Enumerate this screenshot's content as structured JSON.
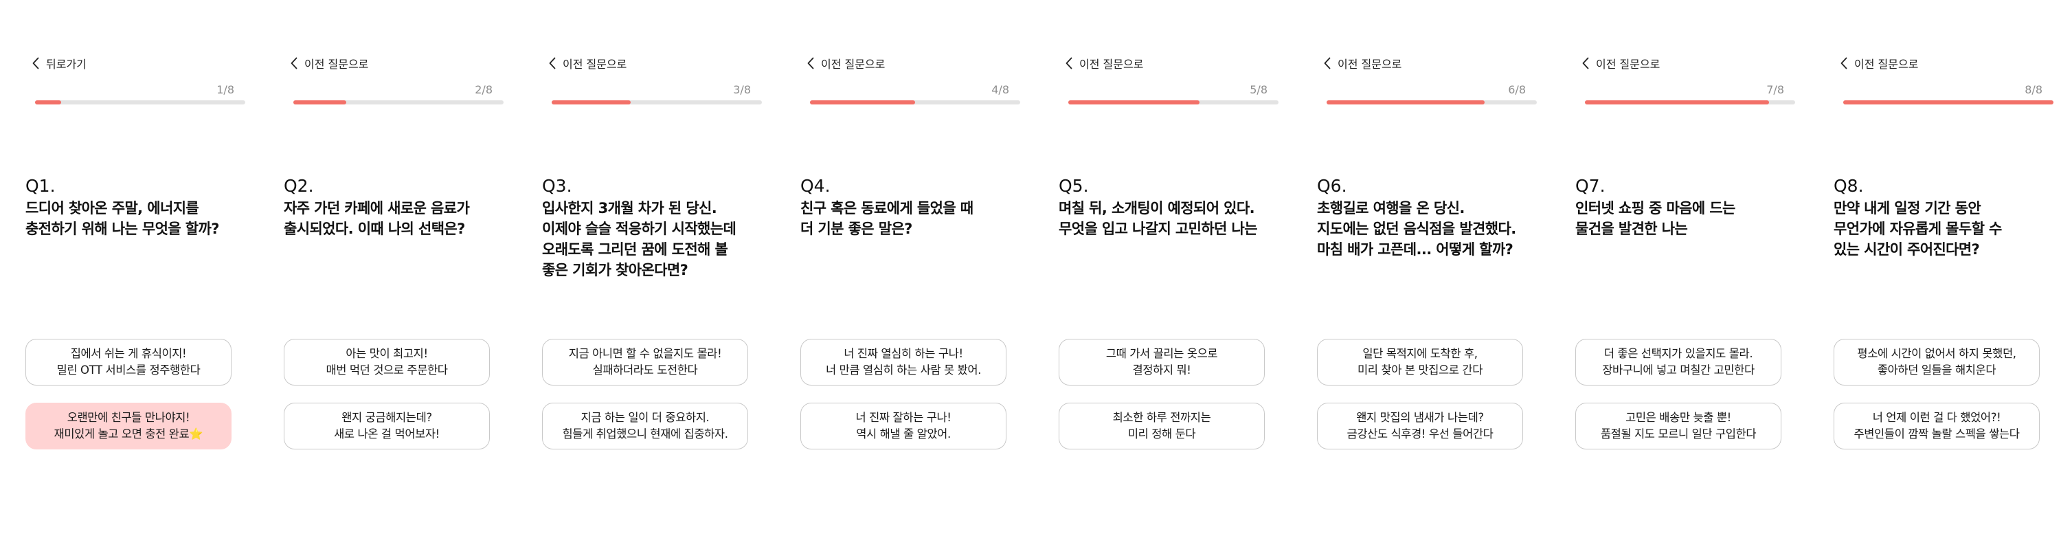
{
  "colors": {
    "accent": "#f27068",
    "track": "#e3e3e3",
    "selected": "#ffd3d3"
  },
  "screens": [
    {
      "back_label": "뒤로가기",
      "counter": "1/8",
      "progress": 0.125,
      "q_num": "Q1.",
      "q_text": "드디어 찾아온 주말, 에너지를\n충전하기 위해 나는 무엇을 할까?",
      "option_a": "집에서 쉬는 게 휴식이지!\n밀린 OTT 서비스를 정주행한다",
      "option_b": "오랜만에 친구들 만나야지!\n재미있게 놀고 오면 충전 완료⭐",
      "selected": "b"
    },
    {
      "back_label": "이전 질문으로",
      "counter": "2/8",
      "progress": 0.25,
      "q_num": "Q2.",
      "q_text": "자주 가던 카페에 새로운 음료가\n출시되었다. 이때 나의 선택은?",
      "option_a": "아는 맛이 최고지!\n매번 먹던 것으로 주문한다",
      "option_b": "왠지 궁금해지는데?\n새로 나온 걸 먹어보자!",
      "selected": ""
    },
    {
      "back_label": "이전 질문으로",
      "counter": "3/8",
      "progress": 0.375,
      "q_num": "Q3.",
      "q_text": "입사한지 3개월 차가 된 당신.\n이제야 슬슬 적응하기 시작했는데\n오래도록 그리던 꿈에 도전해 볼\n좋은 기회가 찾아온다면?",
      "option_a": "지금 아니면 할 수 없을지도 몰라!\n실패하더라도 도전한다",
      "option_b": "지금 하는 일이 더 중요하지.\n힘들게 취업했으니 현재에 집중하자.",
      "selected": ""
    },
    {
      "back_label": "이전 질문으로",
      "counter": "4/8",
      "progress": 0.5,
      "q_num": "Q4.",
      "q_text": "친구 혹은 동료에게 들었을 때\n더 기분 좋은 말은?",
      "option_a": "너 진짜 열심히 하는 구나!\n너 만큼 열심히 하는 사람 못 봤어.",
      "option_b": "너 진짜 잘하는 구나!\n역시 해낼 줄 알았어.",
      "selected": ""
    },
    {
      "back_label": "이전 질문으로",
      "counter": "5/8",
      "progress": 0.625,
      "q_num": "Q5.",
      "q_text": "며칠 뒤, 소개팅이 예정되어 있다.\n무엇을 입고 나갈지 고민하던 나는",
      "option_a": "그때 가서 끌리는 옷으로\n결정하지 뭐!",
      "option_b": "최소한 하루 전까지는\n미리 정해 둔다",
      "selected": ""
    },
    {
      "back_label": "이전 질문으로",
      "counter": "6/8",
      "progress": 0.75,
      "q_num": "Q6.",
      "q_text": "초행길로 여행을 온 당신.\n지도에는 없던 음식점을 발견했다.\n마침 배가 고픈데... 어떻게 할까?",
      "option_a": "일단 목적지에 도착한 후,\n미리 찾아 본 맛집으로 간다",
      "option_b": "왠지 맛집의 냄새가 나는데?\n금강산도 식후경! 우선 들어간다",
      "selected": ""
    },
    {
      "back_label": "이전 질문으로",
      "counter": "7/8",
      "progress": 0.875,
      "q_num": "Q7.",
      "q_text": "인터넷 쇼핑 중 마음에 드는\n물건을 발견한 나는",
      "option_a": "더 좋은 선택지가 있을지도 몰라.\n장바구니에 넣고 며칠간 고민한다",
      "option_b": "고민은 배송만 늦출 뿐!\n품절될 지도 모르니 일단 구입한다",
      "selected": ""
    },
    {
      "back_label": "이전 질문으로",
      "counter": "8/8",
      "progress": 1.0,
      "q_num": "Q8.",
      "q_text": "만약 내게 일정 기간 동안\n무언가에 자유롭게 몰두할 수\n있는 시간이 주어진다면?",
      "option_a": "평소에 시간이 없어서 하지 못했던,\n좋아하던 일들을 해치운다",
      "option_b": "너 언제 이런 걸 다 했었어?!\n주변인들이 깜짝 놀랄 스펙을 쌓는다",
      "selected": ""
    }
  ]
}
